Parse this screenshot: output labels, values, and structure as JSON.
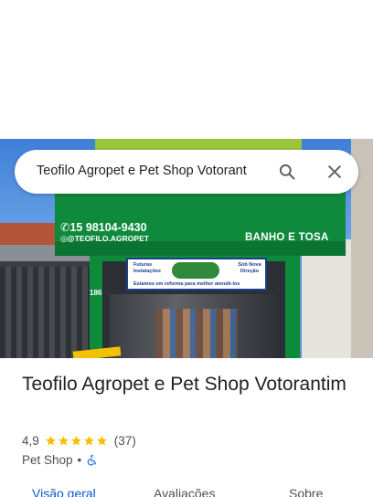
{
  "search": {
    "query": "Teofilo Agropet e Pet Shop Votorant"
  },
  "photo": {
    "sign_phone": "15 98104-9430",
    "sign_instagram": "@TEOFILO.AGROPET",
    "sign_service": "BANHO E TOSA",
    "sign_number": "186",
    "banner_left": "Futuras Instalações",
    "banner_right": "Sob Nova Direção",
    "banner_bottom": "Estamos em reforma para melhor atendê-los"
  },
  "place": {
    "title": "Teofilo Agropet e Pet Shop Votorantim",
    "rating": "4,9",
    "stars": 5,
    "review_count": "(37)",
    "category": "Pet Shop",
    "separator": "•",
    "accessibility_icon": "wheelchair-icon"
  },
  "tabs": [
    {
      "label": "Visão geral",
      "active": true
    },
    {
      "label": "Avaliações",
      "active": false
    },
    {
      "label": "Sobre",
      "active": false
    }
  ],
  "colors": {
    "accent": "#0b57d0",
    "star": "#fbbc04",
    "storefront_green": "#0f8a3c"
  }
}
